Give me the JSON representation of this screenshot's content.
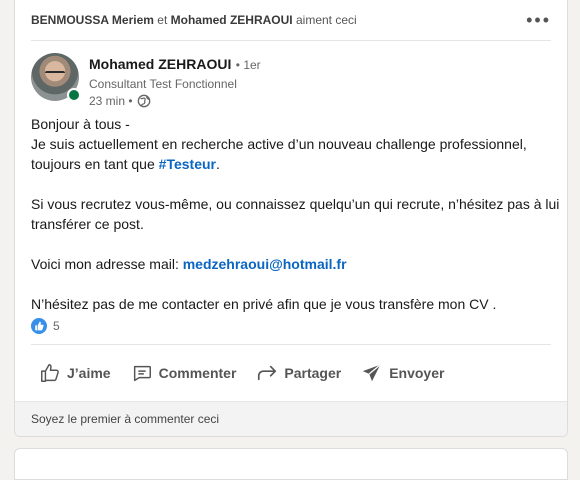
{
  "social": {
    "person1": "BENMOUSSA Meriem",
    "connector": "et",
    "person2": "Mohamed ZEHRAOUI",
    "suffix": "aiment ceci"
  },
  "more_label": "•••",
  "author": {
    "name": "Mohamed ZEHRAOUI",
    "degree": "• 1er",
    "headline": "Consultant Test Fonctionnel",
    "time": "23 min •"
  },
  "post": {
    "line1": "Bonjour à tous -",
    "line2": "Je suis actuellement en recherche active d’un nouveau challenge professionnel,",
    "line3_prefix": "toujours en tant que ",
    "hashtag": "#Testeur",
    "line3_suffix": ".",
    "line4": "Si vous recrutez vous-même, ou connaissez quelqu’un qui recrute, n’hésitez pas à lui",
    "line5": "transférer ce post.",
    "line6_prefix": "Voici mon adresse mail: ",
    "email": "medzehraoui@hotmail.fr",
    "line7": "N’hésitez pas de me contacter en privé afin que je vous transfère mon CV ."
  },
  "reactions": {
    "count": "5"
  },
  "actions": {
    "like": "J’aime",
    "comment": "Commenter",
    "share": "Partager",
    "send": "Envoyer"
  },
  "comments_prompt": "Soyez le premier à commenter ceci",
  "colors": {
    "link": "#0a66c2",
    "presence": "#057642",
    "like": "#378fe9"
  }
}
